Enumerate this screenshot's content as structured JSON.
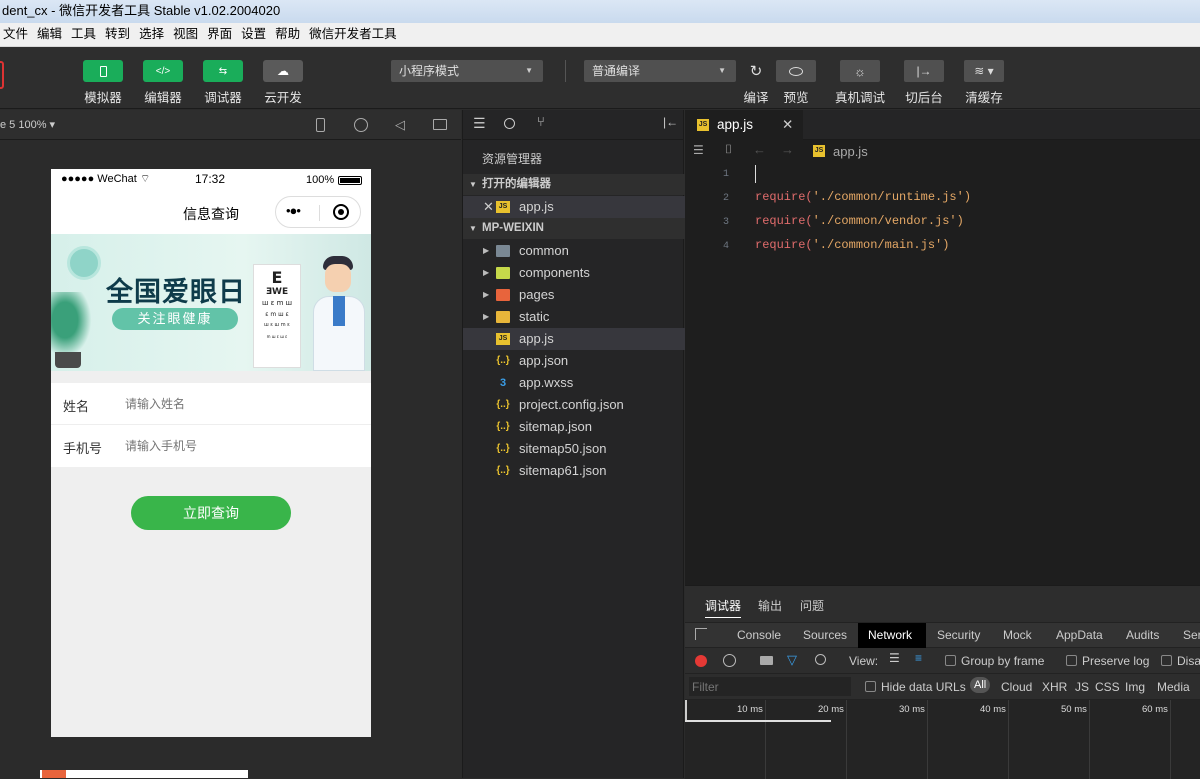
{
  "window": {
    "title": "dent_cx - 微信开发者工具 Stable v1.02.2004020"
  },
  "menu": [
    "文件",
    "编辑",
    "工具",
    "转到",
    "选择",
    "视图",
    "界面",
    "设置",
    "帮助",
    "微信开发者工具"
  ],
  "toolbar": {
    "simulator": "模拟器",
    "editor": "编辑器",
    "debugger": "调试器",
    "cloud": "云开发",
    "mode": "小程序模式",
    "compile_mode": "普通编译",
    "compile": "编译",
    "preview": "预览",
    "real_debug": "真机调试",
    "background": "切后台",
    "clear_cache": "清缓存",
    "icon_editor": "</>",
    "icon_debugger": "⇆"
  },
  "simulator": {
    "device": "e 5 100% ▾",
    "status_left": "●●●●● WeChat",
    "time": "17:32",
    "battery": "100%",
    "nav_title": "信息查询",
    "banner_title": "全国爱眼日",
    "banner_subtitle": "关注眼健康",
    "form": [
      {
        "label": "姓名",
        "placeholder": "请输入姓名"
      },
      {
        "label": "手机号",
        "placeholder": "请输入手机号"
      }
    ],
    "submit": "立即查询"
  },
  "explorer": {
    "title": "资源管理器",
    "open_editors": "打开的编辑器",
    "open_file": "app.js",
    "project": "MP-WEIXIN",
    "folders": [
      "common",
      "components",
      "pages",
      "static"
    ],
    "files": [
      "app.js",
      "app.json",
      "app.wxss",
      "project.config.json",
      "sitemap.json",
      "sitemap50.json",
      "sitemap61.json"
    ]
  },
  "editor": {
    "tab": "app.js",
    "breadcrumb": "app.js",
    "lines": [
      {
        "n": "1",
        "fn": "",
        "arg": ""
      },
      {
        "n": "2",
        "fn": "require(",
        "arg": "'./common/runtime.js')"
      },
      {
        "n": "3",
        "fn": "require(",
        "arg": "'./common/vendor.js')"
      },
      {
        "n": "4",
        "fn": "require(",
        "arg": "'./common/main.js')"
      }
    ]
  },
  "devtools": {
    "panel_tabs": [
      "调试器",
      "输出",
      "问题"
    ],
    "tabs": [
      "Console",
      "Sources",
      "Network",
      "Security",
      "Mock",
      "AppData",
      "Audits",
      "Ser"
    ],
    "active_tab": "Network",
    "view_label": "View:",
    "group_by_frame": "Group by frame",
    "preserve_log": "Preserve log",
    "disable": "Disa",
    "filter_placeholder": "Filter",
    "hide_data_urls": "Hide data URLs",
    "types": [
      "All",
      "Cloud",
      "XHR",
      "JS",
      "CSS",
      "Img",
      "Media"
    ],
    "ticks": [
      "10 ms",
      "20 ms",
      "30 ms",
      "40 ms",
      "50 ms",
      "60 ms"
    ]
  }
}
